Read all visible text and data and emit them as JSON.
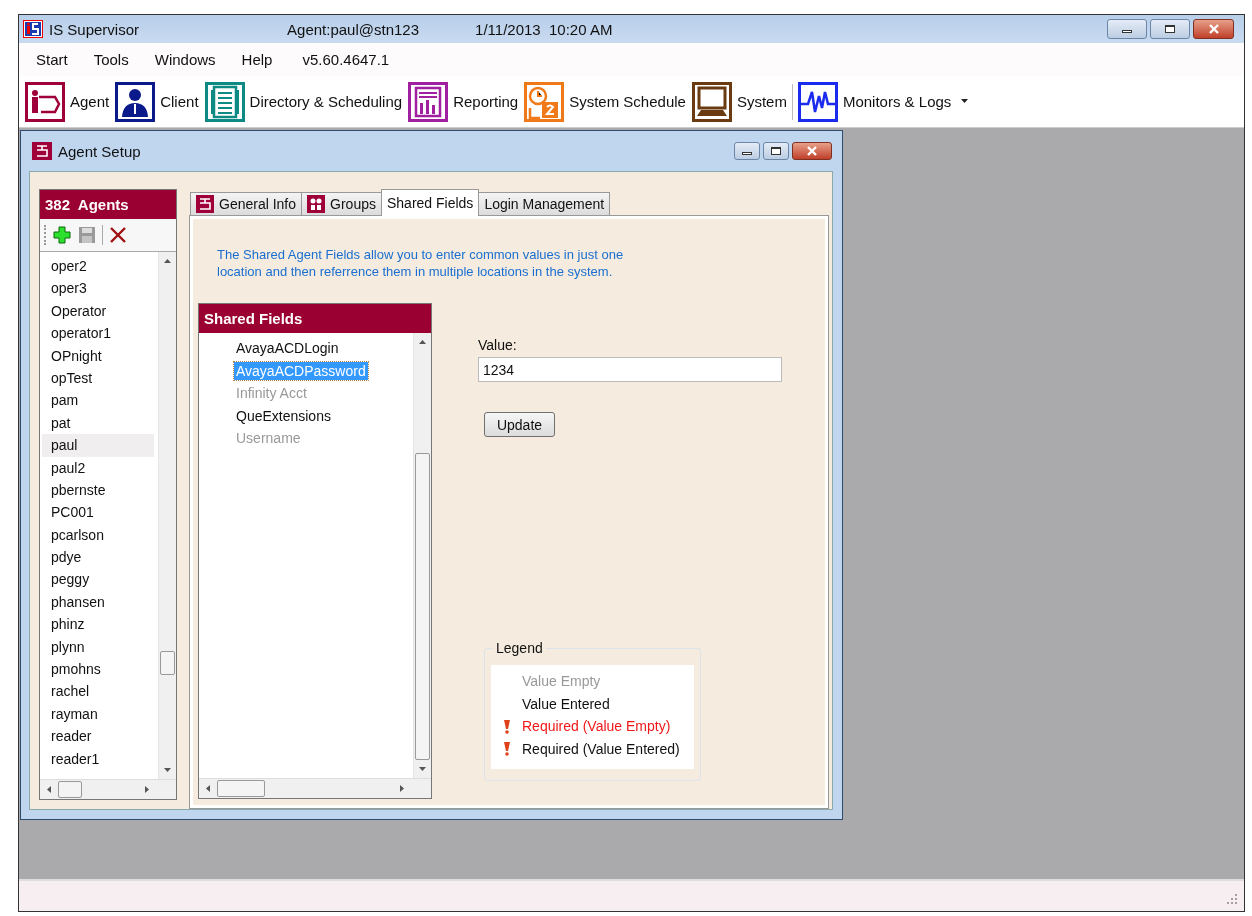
{
  "window": {
    "title": "IS Supervisor",
    "agent": "Agent:paul@stn123",
    "datetime": "1/11/2013  10:20 AM"
  },
  "menu": [
    "Start",
    "Tools",
    "Windows",
    "Help",
    "v5.60.4647.1"
  ],
  "toolbar": [
    {
      "label": "Agent",
      "kind": "agent",
      "color": "#a0003a"
    },
    {
      "label": "Client",
      "kind": "client",
      "color": "#0a1a8a"
    },
    {
      "label": "Directory & Scheduling",
      "kind": "directory",
      "color": "#0e8a84"
    },
    {
      "label": "Reporting",
      "kind": "reporting",
      "color": "#a020a0"
    },
    {
      "label": "System Schedule",
      "kind": "schedule",
      "color": "#f07a1a"
    },
    {
      "label": "System",
      "kind": "system",
      "color": "#6a3a10"
    },
    {
      "label": "Monitors & Logs",
      "kind": "monitors",
      "color": "#1a2aee",
      "dropdown": true
    }
  ],
  "child_window": {
    "title": "Agent Setup",
    "agents": {
      "header": "382  Agents",
      "items": [
        {
          "name": "oper2",
          "selected": false
        },
        {
          "name": "oper3",
          "selected": false
        },
        {
          "name": "Operator",
          "selected": false
        },
        {
          "name": "operator1",
          "selected": false
        },
        {
          "name": "OPnight",
          "selected": false
        },
        {
          "name": "opTest",
          "selected": false
        },
        {
          "name": "pam",
          "selected": false
        },
        {
          "name": "pat",
          "selected": false
        },
        {
          "name": "paul",
          "selected": true
        },
        {
          "name": "paul2",
          "selected": false
        },
        {
          "name": "pbernste",
          "selected": false
        },
        {
          "name": "PC001",
          "selected": false
        },
        {
          "name": "pcarlson",
          "selected": false
        },
        {
          "name": "pdye",
          "selected": false
        },
        {
          "name": "peggy",
          "selected": false
        },
        {
          "name": "phansen",
          "selected": false
        },
        {
          "name": "phinz",
          "selected": false
        },
        {
          "name": "plynn",
          "selected": false
        },
        {
          "name": "pmohns",
          "selected": false
        },
        {
          "name": "rachel",
          "selected": false
        },
        {
          "name": "rayman",
          "selected": false
        },
        {
          "name": "reader",
          "selected": false
        },
        {
          "name": "reader1",
          "selected": false
        }
      ]
    },
    "tabs": [
      {
        "label": "General Info",
        "kind": "form",
        "selected": false
      },
      {
        "label": "Groups",
        "kind": "people",
        "selected": false
      },
      {
        "label": "Shared Fields",
        "kind": "plain",
        "selected": true
      },
      {
        "label": "Login Management",
        "kind": "plain",
        "selected": false
      }
    ],
    "description": "The Shared Agent Fields allow you to enter common values in just one location and then referrence them in multiple locations in the system.",
    "shared_fields": {
      "header": "Shared Fields",
      "items": [
        {
          "name": "AvayaACDLogin",
          "kind": "entered",
          "selected": false
        },
        {
          "name": "AvayaACDPassword",
          "kind": "entered",
          "selected": true
        },
        {
          "name": "Infinity Acct",
          "kind": "empty",
          "selected": false
        },
        {
          "name": "QueExtensions",
          "kind": "entered",
          "selected": false
        },
        {
          "name": "Username",
          "kind": "empty",
          "selected": false
        }
      ]
    },
    "value_label": "Value:",
    "value": "1234",
    "update_button": "Update",
    "legend": {
      "title": "Legend",
      "items": [
        {
          "label": "Value Empty",
          "kind": "empty"
        },
        {
          "label": "Value Entered",
          "kind": "entered"
        },
        {
          "label": "Required (Value Empty)",
          "kind": "required_empty"
        },
        {
          "label": "Required (Value Entered)",
          "kind": "required_entered"
        }
      ]
    }
  }
}
